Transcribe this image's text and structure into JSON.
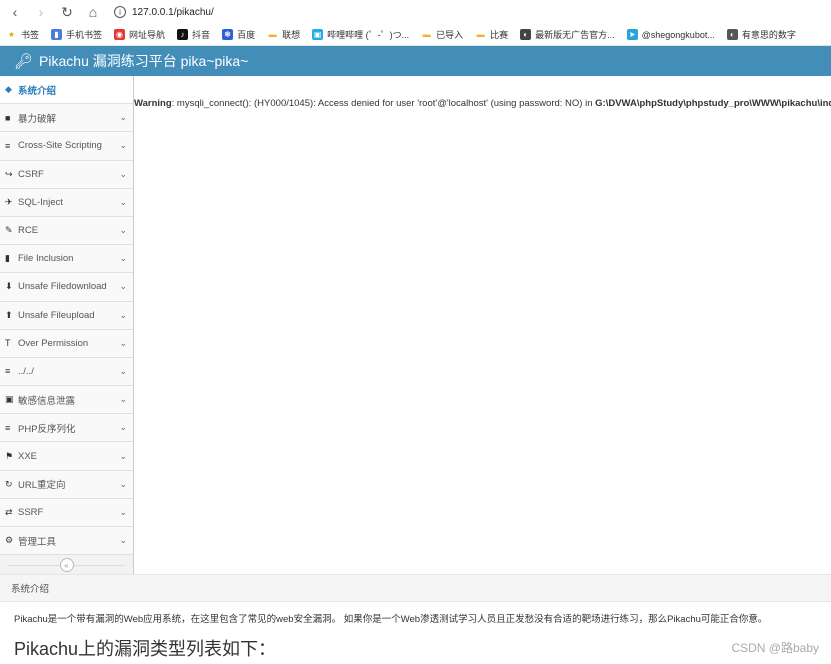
{
  "browser": {
    "url": "127.0.0.1/pikachu/",
    "bookmarks": [
      {
        "label": "书签",
        "icon": "star-icon",
        "color": "#e6a817"
      },
      {
        "label": "手机书签",
        "icon": "phone-icon",
        "color": "#4a7fd9"
      },
      {
        "label": "网址导航",
        "icon": "nav-icon",
        "color": "#e53935"
      },
      {
        "label": "抖音",
        "icon": "douyin-icon",
        "color": "#111111"
      },
      {
        "label": "百度",
        "icon": "baidu-icon",
        "color": "#2e5fd8"
      },
      {
        "label": "联想",
        "icon": "folder-icon",
        "color": "#f0b429"
      },
      {
        "label": "哔哩哔哩 (゜-゜)つ...",
        "icon": "bilibili-icon",
        "color": "#23ade5"
      },
      {
        "label": "已导入",
        "icon": "folder-icon",
        "color": "#f0b429"
      },
      {
        "label": "比赛",
        "icon": "folder-icon",
        "color": "#f0b429"
      },
      {
        "label": "最新版无广告官方...",
        "icon": "site-icon",
        "color": "#444444"
      },
      {
        "label": "@shegongkubot...",
        "icon": "telegram-icon",
        "color": "#2aa3d8"
      },
      {
        "label": "有意思的数字",
        "icon": "site-icon",
        "color": "#555555"
      }
    ]
  },
  "app": {
    "title": "Pikachu 漏洞练习平台 pika~pika~",
    "header_color": "#438eb9"
  },
  "sidebar": {
    "items": [
      {
        "label": "系统介绍",
        "icon": "tag-icon",
        "active": true
      },
      {
        "label": "暴力破解",
        "icon": "fire-icon"
      },
      {
        "label": "Cross-Site Scripting",
        "icon": "indent-icon"
      },
      {
        "label": "CSRF",
        "icon": "share-icon"
      },
      {
        "label": "SQL-Inject",
        "icon": "plane-icon"
      },
      {
        "label": "RCE",
        "icon": "pencil-icon"
      },
      {
        "label": "File Inclusion",
        "icon": "file-icon"
      },
      {
        "label": "Unsafe Filedownload",
        "icon": "download-icon"
      },
      {
        "label": "Unsafe Fileupload",
        "icon": "upload-icon"
      },
      {
        "label": "Over Permission",
        "icon": "text-width-icon"
      },
      {
        "label": "../../",
        "icon": "align-left-icon"
      },
      {
        "label": "敏感信息泄露",
        "icon": "camera-icon"
      },
      {
        "label": "PHP反序列化",
        "icon": "align-left-icon"
      },
      {
        "label": "XXE",
        "icon": "flag-icon"
      },
      {
        "label": "URL重定向",
        "icon": "repeat-icon"
      },
      {
        "label": "SSRF",
        "icon": "exchange-icon"
      },
      {
        "label": "管理工具",
        "icon": "gear-icon"
      }
    ],
    "collapse_icon": "double-chevron-left-icon"
  },
  "main": {
    "warning_prefix": "Warning",
    "warning_text": ": mysqli_connect(): (HY000/1045): Access denied for user 'root'@'localhost' (using password: NO) in ",
    "warning_path": "G:\\DVWA\\phpStudy\\phpstudy_pro\\WWW\\pikachu\\index"
  },
  "breadcrumb": "系统介绍",
  "intro": "Pikachu是一个带有漏洞的Web应用系统，在这里包含了常见的web安全漏洞。 如果你是一个Web渗透测试学习人员且正发愁没有合适的靶场进行练习，那么Pikachu可能正合你意。",
  "heading": "Pikachu上的漏洞类型列表如下：",
  "watermark": "CSDN @路baby"
}
